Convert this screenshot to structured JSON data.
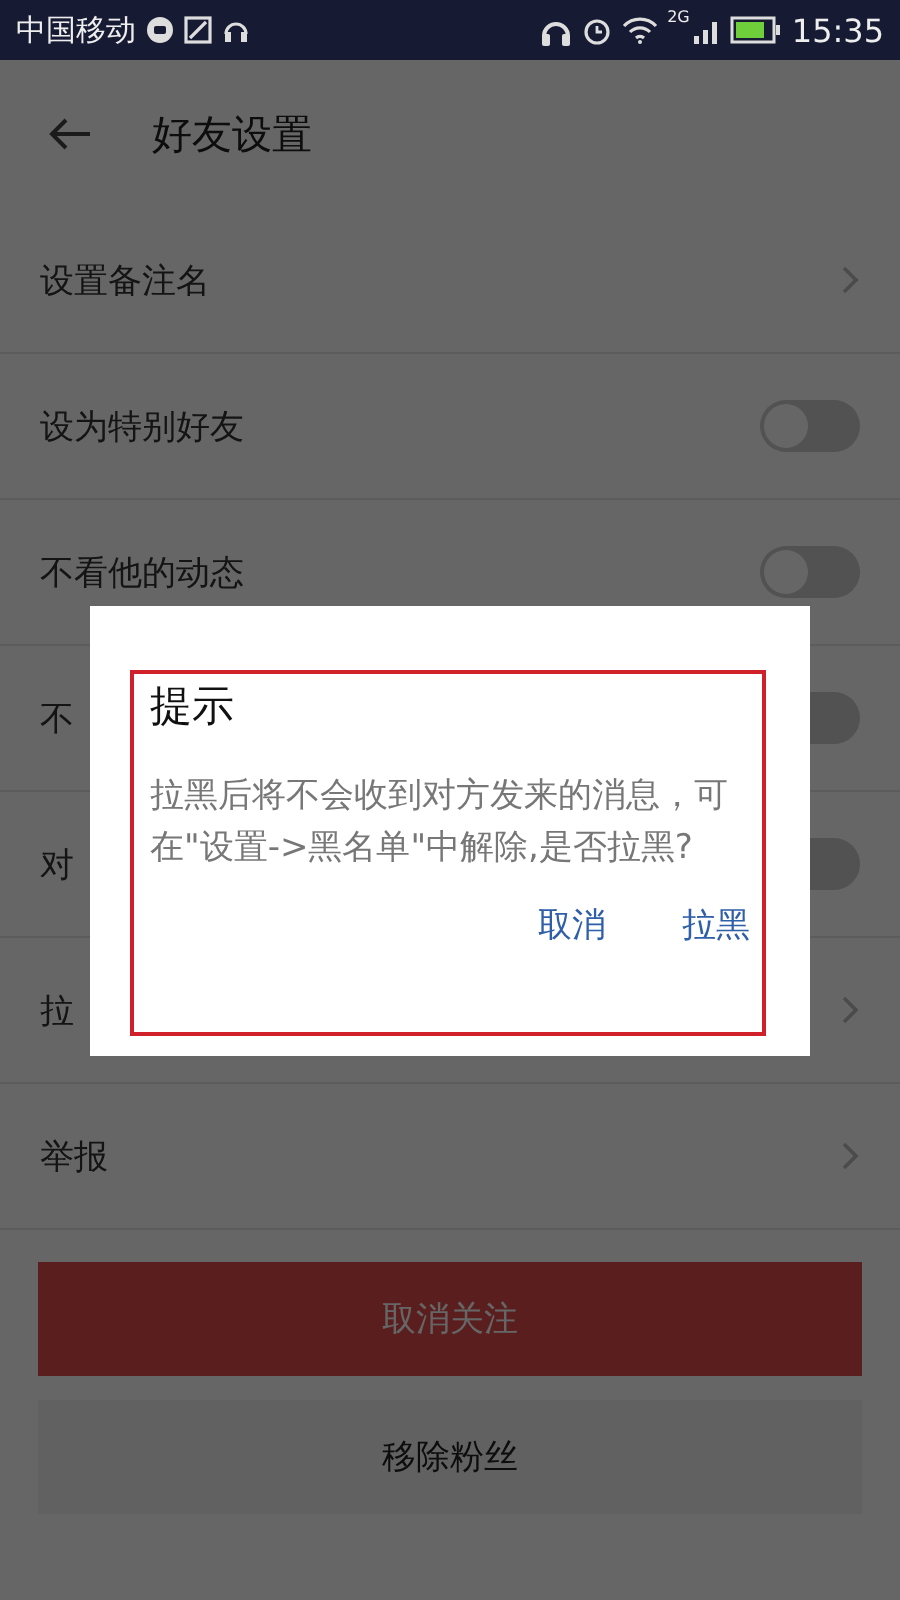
{
  "status_bar": {
    "carrier": "中国移动",
    "network": "2G",
    "time": "15:35"
  },
  "header": {
    "title": "好友设置"
  },
  "rows": [
    {
      "label": "设置备注名",
      "kind": "chevron"
    },
    {
      "label": "设为特别好友",
      "kind": "toggle",
      "on": false
    },
    {
      "label": "不看他的动态",
      "kind": "toggle",
      "on": false
    },
    {
      "label": "不",
      "kind": "toggle",
      "on": false
    },
    {
      "label": "对",
      "kind": "toggle",
      "on": false
    },
    {
      "label": "拉",
      "kind": "chevron"
    },
    {
      "label": "举报",
      "kind": "chevron"
    }
  ],
  "buttons": [
    {
      "label": "取消关注",
      "kind": "danger"
    },
    {
      "label": "移除粉丝",
      "kind": "plain"
    }
  ],
  "dialog": {
    "title": "提示",
    "message": "拉黑后将不会收到对方发来的消息，可在\"设置->黑名单\"中解除,是否拉黑?",
    "actions": [
      "取消",
      "拉黑"
    ]
  }
}
